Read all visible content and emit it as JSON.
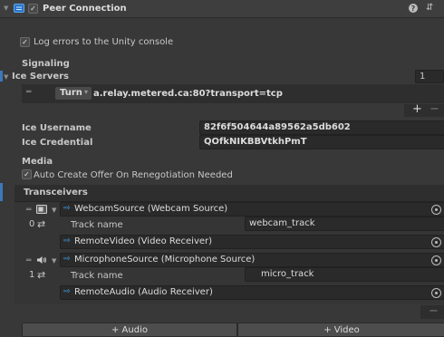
{
  "header": {
    "title": "Peer Connection"
  },
  "log_errors_label": "Log errors to the Unity console",
  "signaling": {
    "section_label": "Signaling",
    "ice_servers_label": "Ice Servers",
    "ice_servers_count": "1",
    "server": {
      "type": "Turn",
      "url": "a.relay.metered.ca:80?transport=tcp"
    },
    "add_symbol": "+",
    "remove_symbol": "−",
    "ice_username_label": "Ice Username",
    "ice_username_value": "82f6f504644a89562a5db602",
    "ice_credential_label": "Ice Credential",
    "ice_credential_value": "QOfkNIKBBVtkhPmT"
  },
  "media": {
    "section_label": "Media",
    "auto_offer_label": "Auto Create Offer On Renegotiation Needed",
    "transceivers_label": "Transceivers",
    "transceivers": [
      {
        "index": "0",
        "source": "WebcamSource (Webcam Source)",
        "track_name_label": "Track name",
        "track_name_value": "webcam_track",
        "receiver": "RemoteVideo (Video Receiver)"
      },
      {
        "index": "1",
        "source": "MicrophoneSource (Microphone Source)",
        "track_name_label": "Track name",
        "track_name_value": "micro_track",
        "receiver": "RemoteAudio (Audio Receiver)"
      }
    ],
    "remove_symbol": "−",
    "add_audio_label": "+ Audio",
    "add_video_label": "+ Video"
  }
}
